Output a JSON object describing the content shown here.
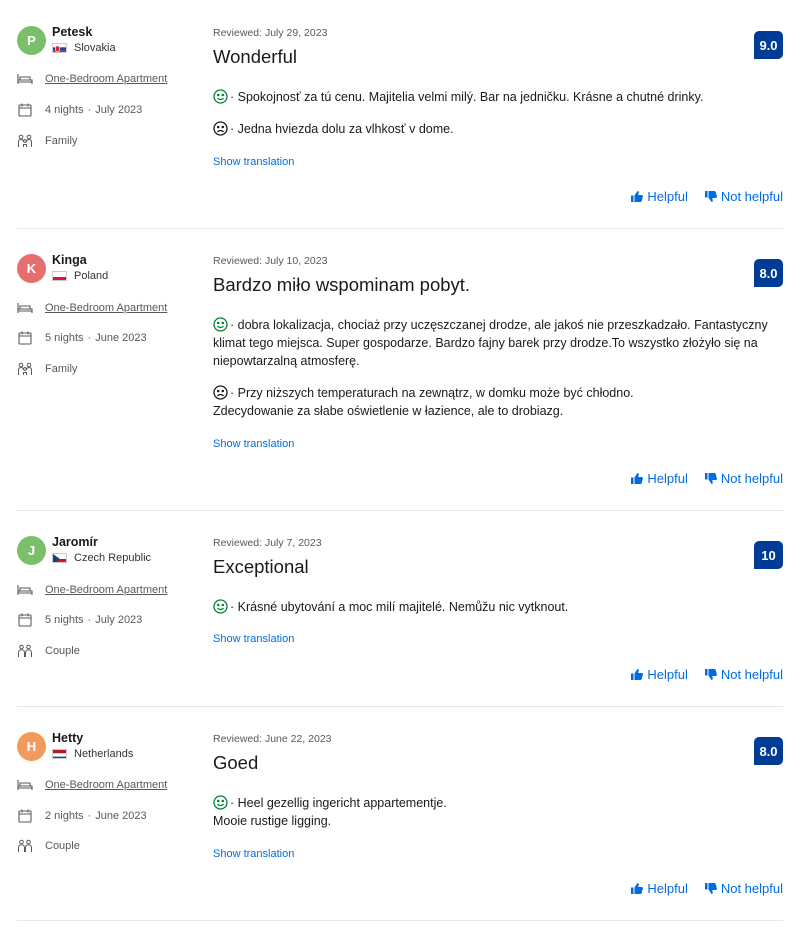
{
  "colors": {
    "score_bg": "#003b95",
    "link": "#006ce4",
    "positive": "#008234",
    "negative": "#1a1a1a"
  },
  "labels": {
    "show_translation": "Show translation",
    "helpful": "Helpful",
    "not_helpful": "Not helpful"
  },
  "reviews": [
    {
      "initial": "P",
      "avatar_color": "#7cbf6b",
      "name": "Petesk",
      "country": "Slovakia",
      "flag": "slovakia",
      "room": "One-Bedroom Apartment",
      "nights": "4 nights",
      "month": "July 2023",
      "traveler_type": "Family",
      "traveler_icon": "family-icon",
      "reviewed": "Reviewed: July 29, 2023",
      "title": "Wonderful",
      "score": "9.0",
      "positive": "· Spokojnosť za tú cenu. Majitelia velmi milý. Bar na jedničku. Krásne a chutné drinky.",
      "negative": "· Jedna hviezda dolu za vlhkosť v dome."
    },
    {
      "initial": "K",
      "avatar_color": "#e56f6f",
      "name": "Kinga",
      "country": "Poland",
      "flag": "poland",
      "room": "One-Bedroom Apartment",
      "nights": "5 nights",
      "month": "June 2023",
      "traveler_type": "Family",
      "traveler_icon": "family-icon",
      "reviewed": "Reviewed: July 10, 2023",
      "title": "Bardzo miło wspominam pobyt.",
      "score": "8.0",
      "positive": "· dobra lokalizacja, chociaż przy uczęszczanej drodze, ale jakoś nie przeszkadzało. Fantastyczny klimat tego miejsca. Super gospodarze. Bardzo fajny barek przy drodze.To wszystko złożyło się na niepowtarzalną atmosferę.",
      "negative": "· Przy niższych temperaturach na zewnątrz, w domku może być chłodno. Zdecydowanie za słabe oświetlenie w łazience, ale to drobiazg."
    },
    {
      "initial": "J",
      "avatar_color": "#7cbf6b",
      "name": "Jaromír",
      "country": "Czech Republic",
      "flag": "czech",
      "room": "One-Bedroom Apartment",
      "nights": "5 nights",
      "month": "July 2023",
      "traveler_type": "Couple",
      "traveler_icon": "couple-icon",
      "reviewed": "Reviewed: July 7, 2023",
      "title": "Exceptional",
      "score": "10",
      "positive": "· Krásné ubytování a moc milí majitelé. Nemůžu nic vytknout.",
      "negative": ""
    },
    {
      "initial": "H",
      "avatar_color": "#f09a5b",
      "name": "Hetty",
      "country": "Netherlands",
      "flag": "netherlands",
      "room": "One-Bedroom Apartment",
      "nights": "2 nights",
      "month": "June 2023",
      "traveler_type": "Couple",
      "traveler_icon": "couple-icon",
      "reviewed": "Reviewed: June 22, 2023",
      "title": "Goed",
      "score": "8.0",
      "positive": "· Heel gezellig ingericht appartementje. Mooie rustige ligging.",
      "negative": ""
    }
  ]
}
